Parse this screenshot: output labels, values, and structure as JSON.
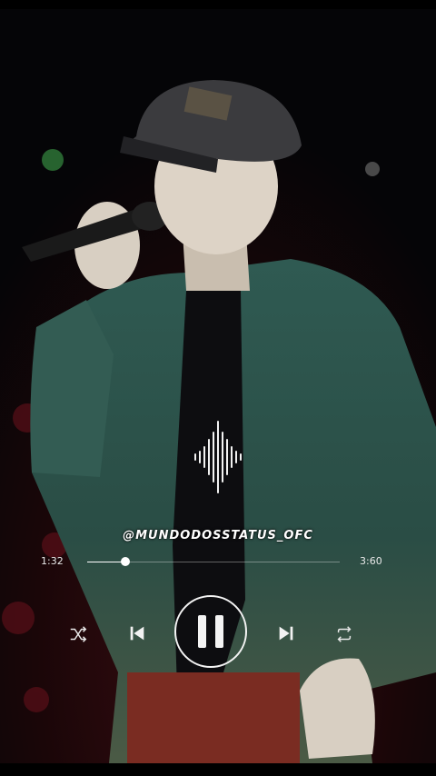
{
  "player": {
    "watermark": "@MUNDODOSSTATUS_OFC",
    "time_current": "1:32",
    "time_total": "3:60",
    "progress_fraction": 0.15,
    "accent_color": "#ffffff"
  },
  "icons": {
    "waveform": "audio-waveform-icon",
    "shuffle": "shuffle-icon",
    "previous": "skip-previous-icon",
    "pause": "pause-icon",
    "next": "skip-next-icon",
    "repeat": "repeat-icon"
  }
}
